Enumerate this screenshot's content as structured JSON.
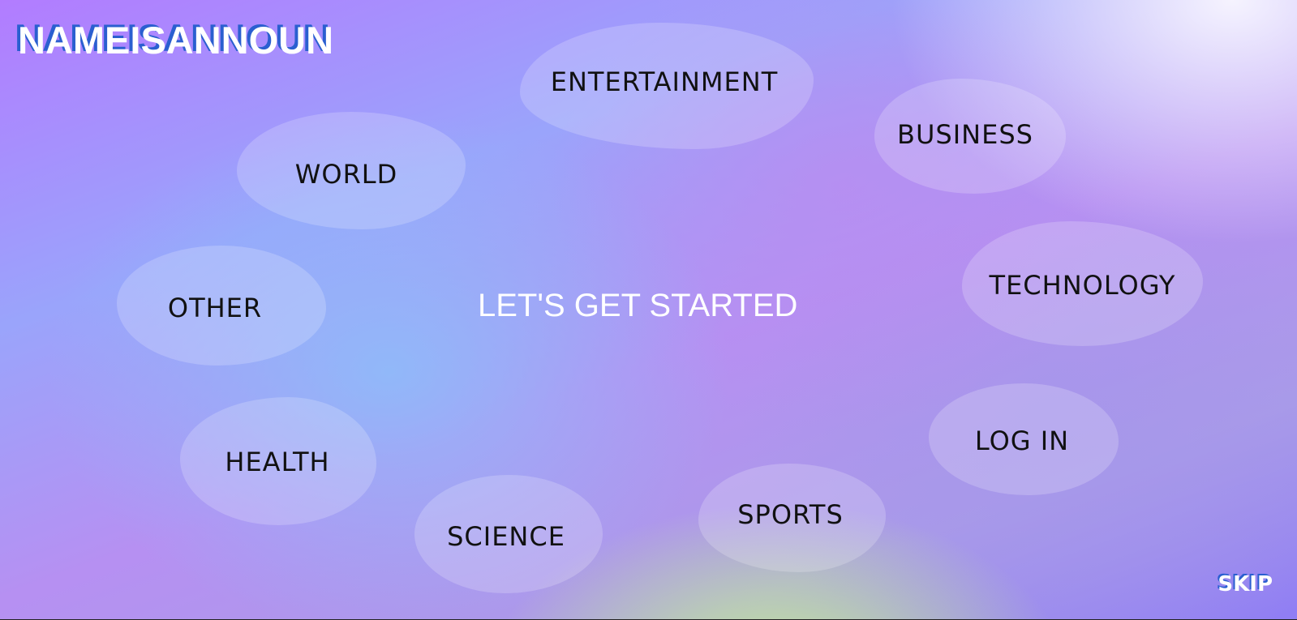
{
  "header": {
    "logo_text": "NAMEISANNOUN"
  },
  "main": {
    "title": "LET'S GET STARTED"
  },
  "categories": [
    {
      "label": "ENTERTAINMENT"
    },
    {
      "label": "BUSINESS"
    },
    {
      "label": "WORLD"
    },
    {
      "label": "TECHNOLOGY"
    },
    {
      "label": "OTHER"
    },
    {
      "label": "HEALTH"
    },
    {
      "label": "SCIENCE"
    },
    {
      "label": "SPORTS"
    }
  ],
  "login": {
    "label": "LOG IN"
  },
  "footer": {
    "skip_label": "SKIP"
  },
  "colors": {
    "logo_shadow": "#2a5fd0",
    "text_on_bubble": "#111111",
    "title_text": "#ffffff"
  }
}
